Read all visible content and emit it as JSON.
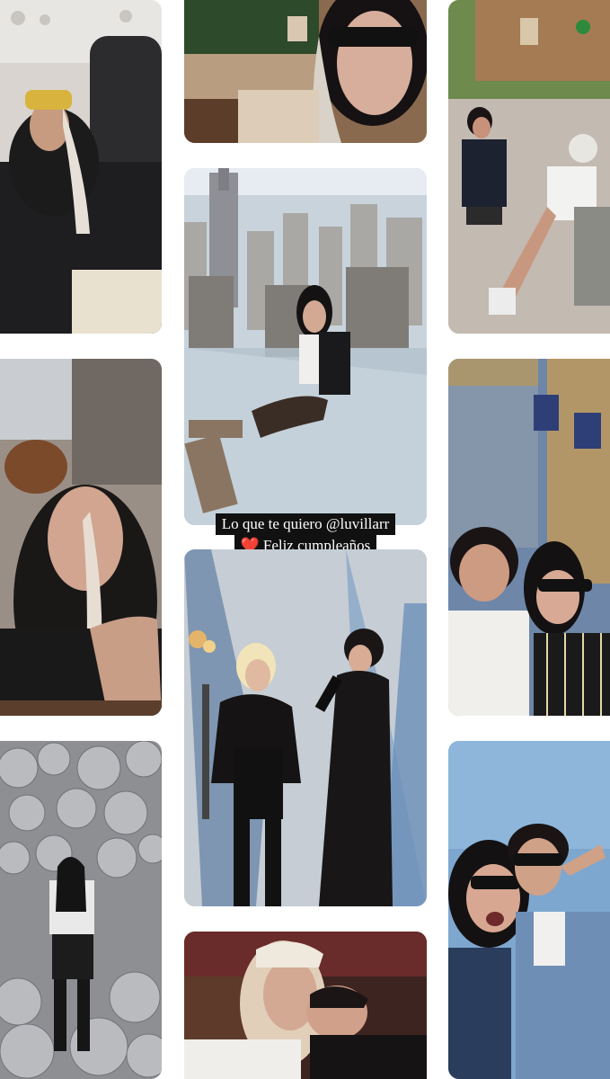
{
  "story": {
    "caption_line1": "Lo que te quiero @luvillarr",
    "caption_heart": "❤️",
    "caption_line2": "Feliz cumpleaños"
  },
  "photos": [
    {
      "id": "airplane-selfie",
      "description_icon": "photo-icon"
    },
    {
      "id": "sunglasses-closeup",
      "description_icon": "photo-icon"
    },
    {
      "id": "theme-park-walk",
      "description_icon": "photo-icon"
    },
    {
      "id": "skyscraper-glass-ledge",
      "description_icon": "photo-icon"
    },
    {
      "id": "eating-turkey-leg",
      "description_icon": "photo-icon"
    },
    {
      "id": "castle-selfie",
      "description_icon": "photo-icon"
    },
    {
      "id": "interview-microphone",
      "description_icon": "photo-icon"
    },
    {
      "id": "mirror-balls-room",
      "description_icon": "photo-icon"
    },
    {
      "id": "couple-selfie-sky",
      "description_icon": "photo-icon"
    },
    {
      "id": "couple-leaning",
      "description_icon": "photo-icon"
    }
  ],
  "colors": {
    "background": "#ffffff",
    "caption_bg": "#111111",
    "caption_text": "#ffffff",
    "heart": "#e0282e"
  }
}
